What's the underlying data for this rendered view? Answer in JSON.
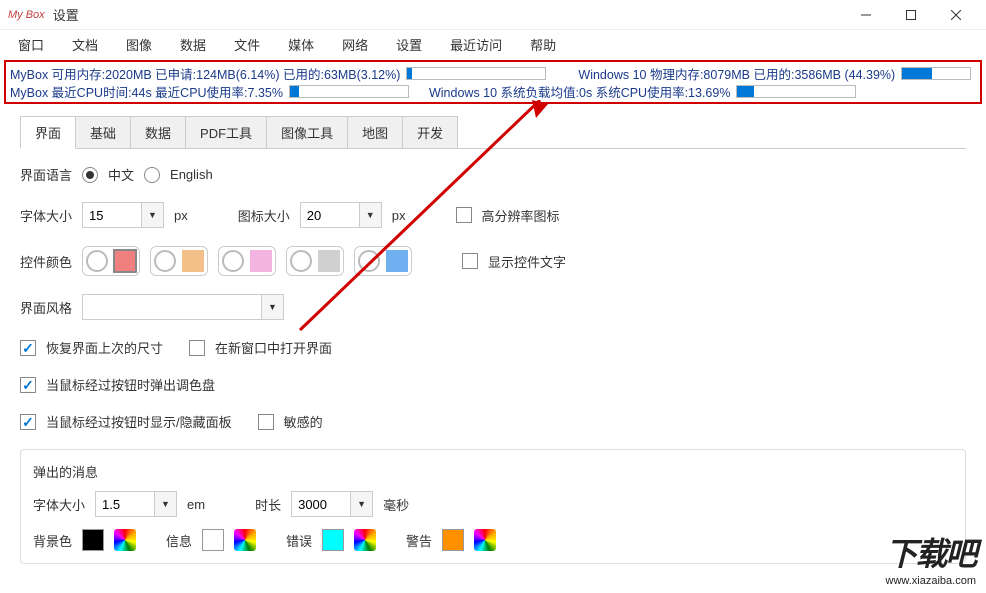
{
  "window": {
    "logo": "My Box",
    "title": "设置"
  },
  "menubar": [
    "窗口",
    "文档",
    "图像",
    "数据",
    "文件",
    "媒体",
    "网络",
    "设置",
    "最近访问",
    "帮助"
  ],
  "status": {
    "line1_left": "MyBox 可用内存:2020MB 已申请:124MB(6.14%) 已用的:63MB(3.12%)",
    "line1_bar1_pct": 3.12,
    "line1_right": "Windows 10 物理内存:8079MB 已用的:3586MB (44.39%)",
    "line1_bar2_pct": 44.39,
    "line2_left": "MyBox 最近CPU时间:44s 最近CPU使用率:7.35%",
    "line2_bar1_pct": 7.35,
    "line2_right": "Windows 10 系统负载均值:0s 系统CPU使用率:13.69%",
    "line2_bar2_pct": 13.69
  },
  "tabs": [
    "界面",
    "基础",
    "数据",
    "PDF工具",
    "图像工具",
    "地图",
    "开发"
  ],
  "lang": {
    "label": "界面语言",
    "opt1": "中文",
    "opt2": "English"
  },
  "font": {
    "label": "字体大小",
    "value": "15",
    "unit": "px"
  },
  "icon": {
    "label": "图标大小",
    "value": "20",
    "unit": "px"
  },
  "hidpi": {
    "label": "高分辨率图标"
  },
  "colors": {
    "label": "控件颜色",
    "swatches": [
      "#f08080",
      "#f4c08a",
      "#f4b4e0",
      "#d0d0d0",
      "#70b0f0"
    ],
    "showtext": "显示控件文字"
  },
  "style": {
    "label": "界面风格",
    "value": ""
  },
  "restore": {
    "label": "恢复界面上次的尺寸"
  },
  "newwin": {
    "label": "在新窗口中打开界面"
  },
  "palette": {
    "label": "当鼠标经过按钮时弹出调色盘"
  },
  "panel": {
    "label": "当鼠标经过按钮时显示/隐藏面板"
  },
  "sensitive": {
    "label": "敏感的"
  },
  "popup": {
    "title": "弹出的消息",
    "font_label": "字体大小",
    "font_value": "1.5",
    "font_unit": "em",
    "dur_label": "时长",
    "dur_value": "3000",
    "dur_unit": "毫秒",
    "bg_label": "背景色",
    "info_label": "信息",
    "err_label": "错误",
    "warn_label": "警告",
    "bg_color": "#000000",
    "info_color": "#ffffff",
    "err_color": "#00ffff",
    "warn_color": "#ff9000"
  },
  "watermark": {
    "big": "下载吧",
    "url": "www.xiazaiba.com"
  }
}
